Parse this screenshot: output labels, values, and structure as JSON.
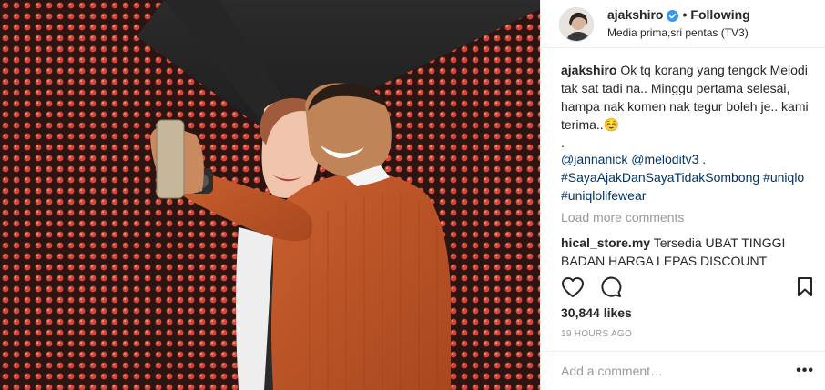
{
  "post": {
    "username": "ajakshiro",
    "follow_status": "Following",
    "location": "Media prima,sri pentas (TV3)",
    "caption_user": "ajakshiro",
    "caption_text": "Ok tq korang yang tengok Melodi tak sat tadi na.. Minggu pertama selesai, hampa nak komen nak tegur boleh je.. kami terima..☺️",
    "caption_dot": ".",
    "mentions": "@jannanick @meloditv3",
    "mentions_suffix": " .",
    "hashtags": "#SayaAjakDanSayaTidakSombong #uniqlo #uniqlolifewear",
    "load_more": "Load more comments",
    "comment_user": "hical_store.my",
    "comment_text": "Tersedia UBAT TINGGI BADAN HARGA LEPAS DISCOUNT",
    "likes": "30,844 likes",
    "timestamp": "19 HOURS AGO",
    "comment_placeholder": "Add a comment…",
    "more_label": "•••"
  },
  "icons": {
    "verified": "verified-badge-icon",
    "like": "heart-icon",
    "comment": "comment-bubble-icon",
    "save": "bookmark-icon"
  },
  "colors": {
    "link": "#003569",
    "verified": "#3897f0",
    "muted": "#999999",
    "led": "#d2473a",
    "sweater": "#c7582a"
  }
}
